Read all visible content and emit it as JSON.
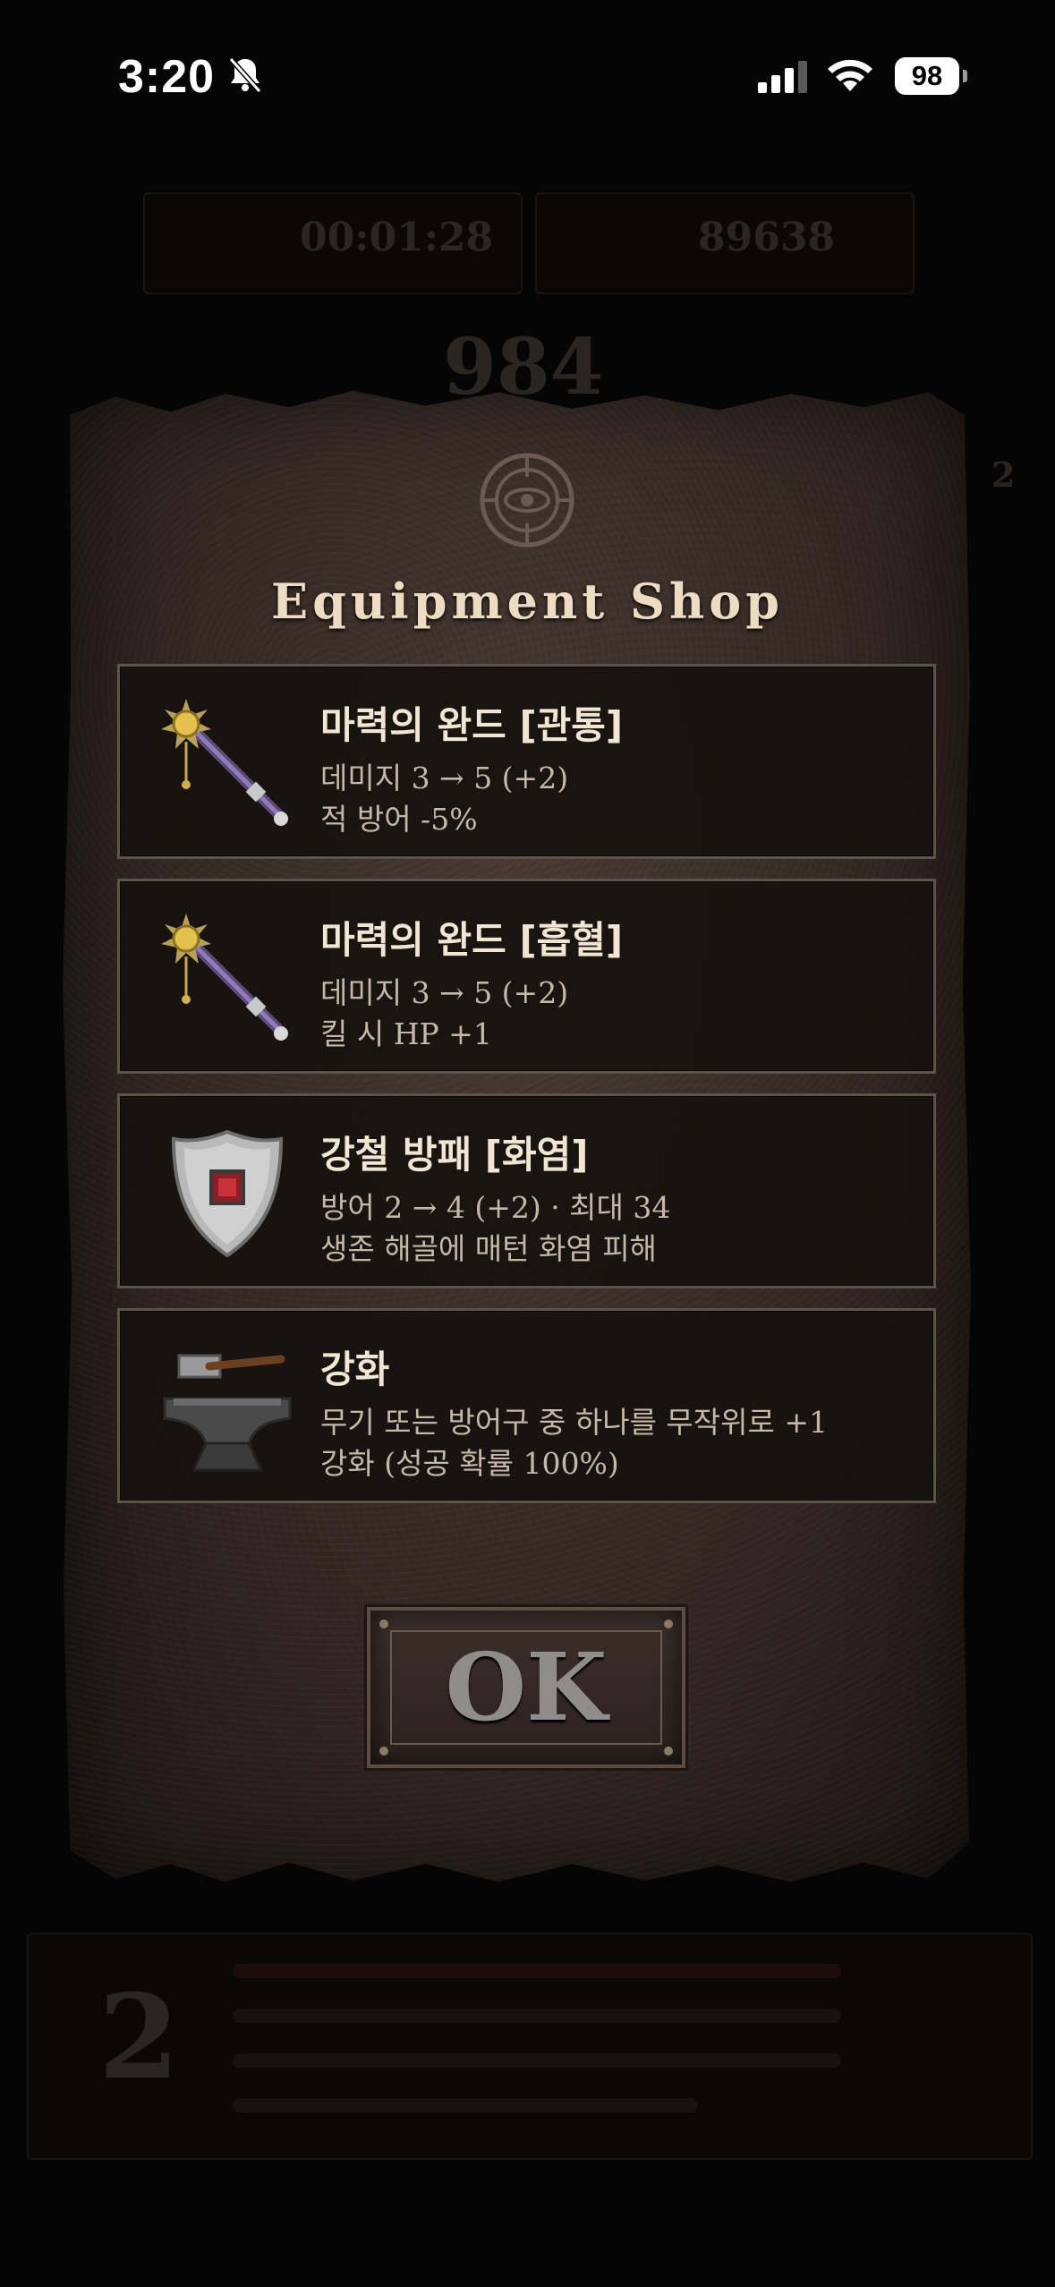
{
  "status_bar": {
    "time": "3:20",
    "battery": "98"
  },
  "background_hud": {
    "timer": "00:01:28",
    "score": "89638",
    "center_value": "984",
    "side_value": "2",
    "level_glyph": "2"
  },
  "shop": {
    "title": "Equipment Shop",
    "items": [
      {
        "name": "마력의 완드 [관통]",
        "line1": "데미지 3 → 5 (+2)",
        "line2": "적 방어 -5%",
        "icon": "magic-wand-icon"
      },
      {
        "name": "마력의 완드 [흡혈]",
        "line1": "데미지 3 → 5 (+2)",
        "line2": "킬 시 HP +1",
        "icon": "magic-wand-icon"
      },
      {
        "name": "강철 방패 [화염]",
        "line1": "방어 2 → 4 (+2) · 최대 34",
        "line2": "생존 해골에 매턴 화염 피해",
        "icon": "steel-shield-icon"
      },
      {
        "name": "강화",
        "line1": "무기 또는 방어구 중 하나를 무작위로 +1",
        "line2": "강화 (성공 확률 100%)",
        "icon": "anvil-hammer-icon"
      }
    ],
    "ok_label": "OK"
  },
  "colors": {
    "parchment": "#3a2d28",
    "card_border": "#5e5348",
    "title_text": "#ecdcc3"
  }
}
